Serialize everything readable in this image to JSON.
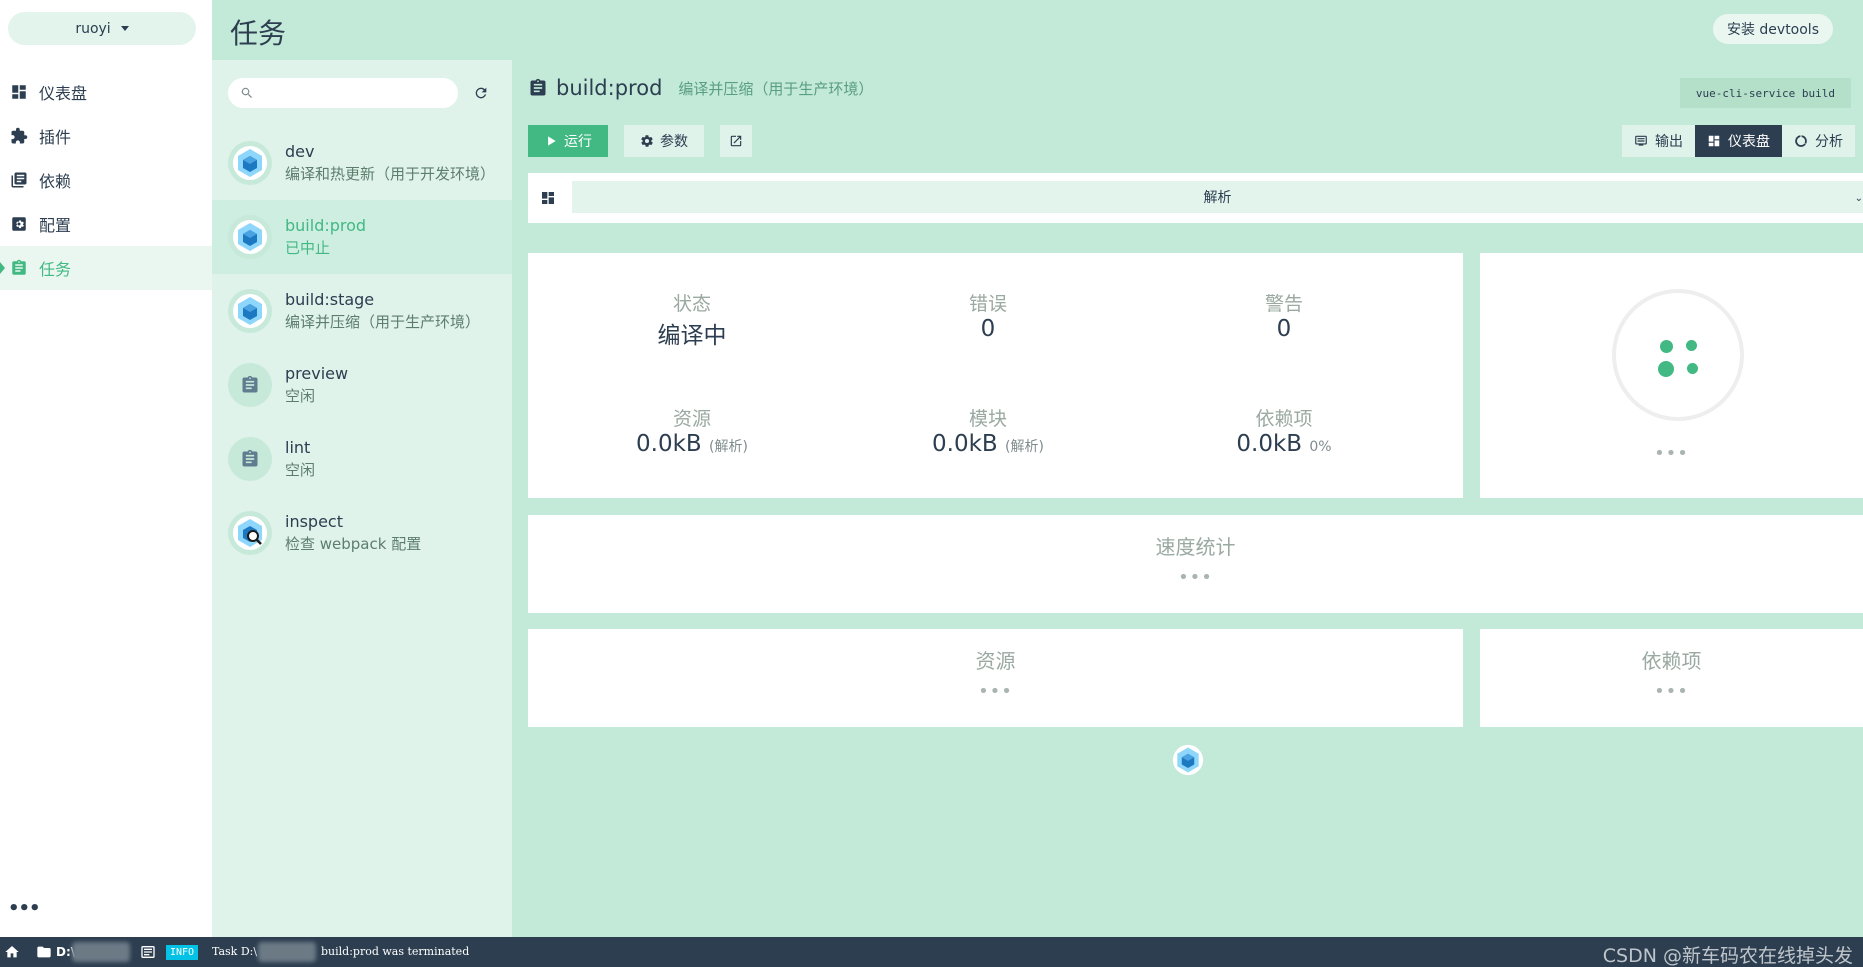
{
  "project": {
    "name": "ruoyi"
  },
  "sidebar": {
    "items": [
      {
        "label": "仪表盘",
        "icon": "dashboard-icon"
      },
      {
        "label": "插件",
        "icon": "puzzle-icon"
      },
      {
        "label": "依赖",
        "icon": "library-icon"
      },
      {
        "label": "配置",
        "icon": "settings-icon"
      },
      {
        "label": "任务",
        "icon": "task-icon",
        "active": true
      }
    ],
    "more_label": "•••"
  },
  "header": {
    "title": "任务",
    "devtools_label": "安装 devtools"
  },
  "task_list": {
    "search_value": "",
    "tasks": [
      {
        "name": "dev",
        "desc": "编译和热更新（用于开发环境）",
        "icon": "webpack-cube-icon"
      },
      {
        "name": "build:prod",
        "desc": "已中止",
        "icon": "webpack-cube-icon",
        "active": true
      },
      {
        "name": "build:stage",
        "desc": "编译并压缩（用于生产环境）",
        "icon": "webpack-cube-icon"
      },
      {
        "name": "preview",
        "desc": "空闲",
        "icon": "clipboard-icon"
      },
      {
        "name": "lint",
        "desc": "空闲",
        "icon": "clipboard-icon"
      },
      {
        "name": "inspect",
        "desc": "检查 webpack 配置",
        "icon": "webpack-inspect-icon"
      }
    ]
  },
  "task_detail": {
    "name": "build:prod",
    "desc": "编译并压缩（用于生产环境）",
    "command": "vue-cli-service build",
    "run_label": "运行",
    "params_label": "参数",
    "view_tabs": [
      {
        "label": "输出",
        "icon": "terminal-icon"
      },
      {
        "label": "仪表盘",
        "icon": "dashboard-icon",
        "active": true
      },
      {
        "label": "分析",
        "icon": "analyze-icon"
      }
    ],
    "mode_select": "解析",
    "stats": {
      "status_label": "状态",
      "status_value": "编译中",
      "errors_label": "错误",
      "errors_value": "0",
      "warnings_label": "警告",
      "warnings_value": "0",
      "assets_label": "资源",
      "assets_value": "0.0kB",
      "assets_note": "(解析)",
      "modules_label": "模块",
      "modules_value": "0.0kB",
      "modules_note": "(解析)",
      "deps_label": "依赖项",
      "deps_value": "0.0kB",
      "deps_note": "0%"
    },
    "progress_dots": "•••",
    "speed_title": "速度统计",
    "assets_title": "资源",
    "deps_title": "依赖项",
    "placeholder_dots": "•••"
  },
  "statusbar": {
    "path_prefix": "D:\\",
    "log_level": "INFO",
    "message_prefix": "Task D:\\",
    "message": "build:prod was terminated",
    "watermark": "CSDN @新车码农在线掉头发"
  },
  "colors": {
    "accent": "#42b983",
    "dark": "#2c3e50",
    "panel": "#c3e9d8"
  }
}
